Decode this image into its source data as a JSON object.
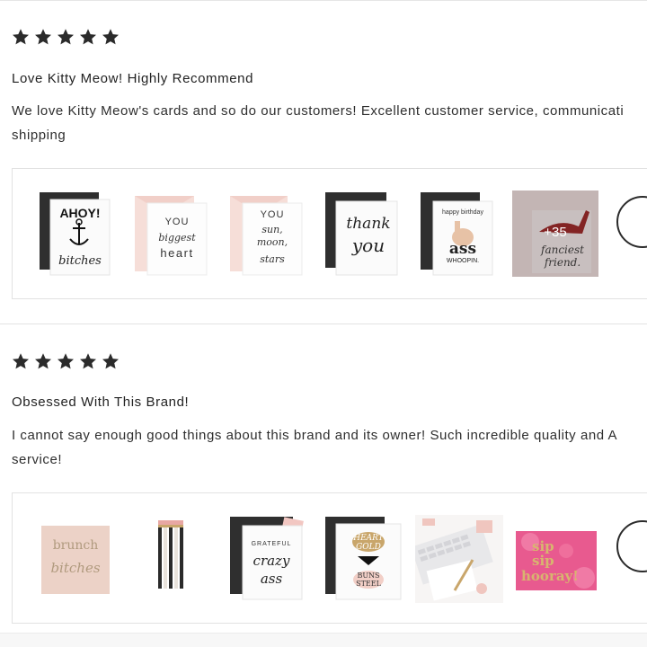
{
  "reviews": [
    {
      "rating": 5,
      "title": "Love Kitty Meow! Highly Recommend",
      "body_line1": "We love Kitty Meow's cards and so do our customers! Excellent customer service, communicati",
      "body_line2": "shipping",
      "photos": [
        {
          "icon": "ahoy-card-icon",
          "text": [
            "AHOY!",
            "bitches"
          ]
        },
        {
          "icon": "biggest-heart-card-icon",
          "text": [
            "YOU",
            "biggest",
            "heart"
          ]
        },
        {
          "icon": "sun-moon-stars-card-icon",
          "text": [
            "YOU",
            "sun,",
            "moon,",
            "stars"
          ]
        },
        {
          "icon": "thank-you-card-icon",
          "text": [
            "thank",
            "you"
          ]
        },
        {
          "icon": "ass-whoopin-card-icon",
          "text": [
            "happy birthday",
            "ass",
            "WHOOPIN."
          ]
        },
        {
          "icon": "fanciest-friend-card-icon",
          "text": [
            "fanciest",
            "friend."
          ]
        }
      ],
      "more_count": "+35"
    },
    {
      "rating": 5,
      "title": "Obsessed With This Brand!",
      "body_line1": "I cannot say enough good things about this brand and its owner! Such incredible quality and A",
      "body_line2": "service!",
      "photos": [
        {
          "icon": "brunch-card-icon",
          "text": [
            "brunch",
            "bitches"
          ]
        },
        {
          "icon": "pencils-icon",
          "text": []
        },
        {
          "icon": "crazy-ass-card-icon",
          "text": [
            "GRATEFUL",
            "crazy",
            "ass"
          ]
        },
        {
          "icon": "heart-of-gold-card-icon",
          "text": [
            "HEART",
            "GOLD",
            "BUNS",
            "STEEL"
          ]
        },
        {
          "icon": "desk-flatlay-icon",
          "text": []
        },
        {
          "icon": "sip-sip-hooray-card-icon",
          "text": [
            "sip",
            "sip",
            "hooray!"
          ]
        }
      ]
    }
  ],
  "colors": {
    "star": "#2b2b2b",
    "text": "#2b2b2b",
    "border": "#e2e2e2",
    "blush": "#f3d9d3",
    "dark_envelope": "#2f2f2f",
    "gold": "#c9a66b"
  }
}
